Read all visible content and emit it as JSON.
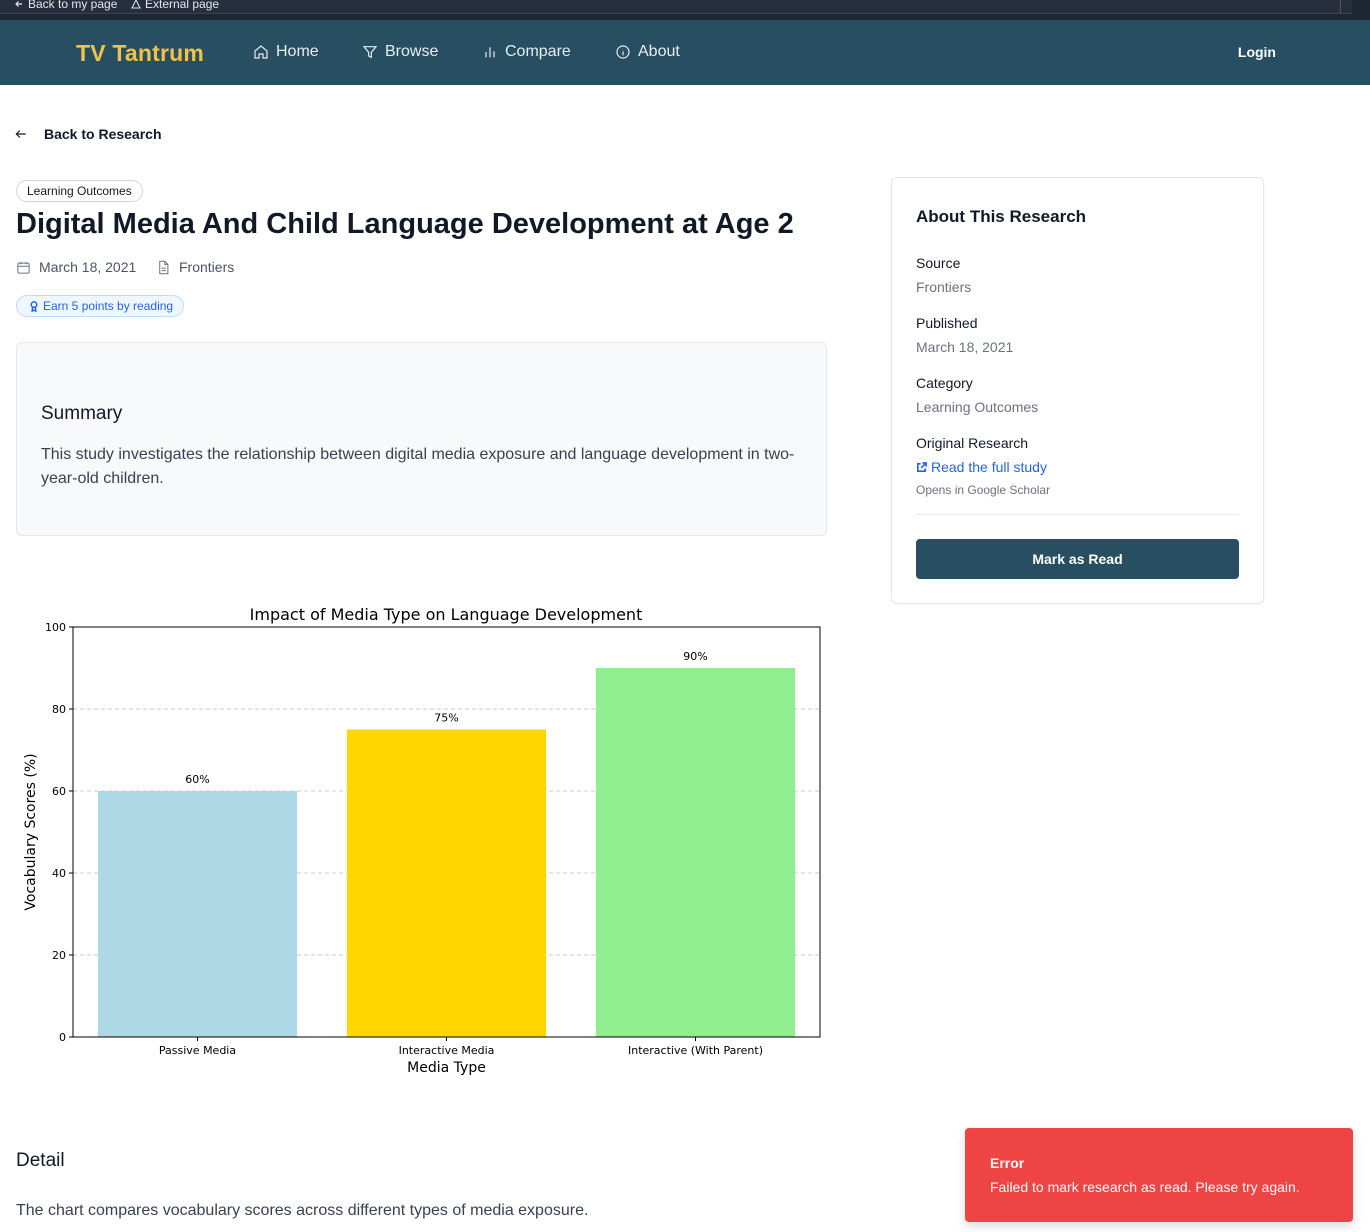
{
  "browser_bar": {
    "back_label": "Back to my page",
    "external_label": "External page"
  },
  "nav": {
    "logo": "TV Tantrum",
    "items": [
      {
        "label": "Home",
        "icon": "home-icon"
      },
      {
        "label": "Browse",
        "icon": "filter-icon"
      },
      {
        "label": "Compare",
        "icon": "bar-chart-icon"
      },
      {
        "label": "About",
        "icon": "info-icon"
      }
    ],
    "login": "Login"
  },
  "back_link": "Back to Research",
  "article": {
    "category": "Learning Outcomes",
    "title": "Digital Media And Child Language Development at Age 2",
    "date": "March 18, 2021",
    "source": "Frontiers",
    "earn_badge": "Earn 5 points by reading",
    "summary_heading": "Summary",
    "summary_text": "This study investigates the relationship between digital media exposure and language development in two-year-old children.",
    "detail_heading": "Detail",
    "detail_text": "The chart compares vocabulary scores across different types of media exposure."
  },
  "chart_data": {
    "type": "bar",
    "title": "Impact of Media Type on Language Development",
    "xlabel": "Media Type",
    "ylabel": "Vocabulary Scores (%)",
    "categories": [
      "Passive Media",
      "Interactive Media",
      "Interactive (With Parent)"
    ],
    "values": [
      60,
      75,
      90
    ],
    "data_labels": [
      "60%",
      "75%",
      "90%"
    ],
    "colors": [
      "#add8e6",
      "#ffd700",
      "#90ee90"
    ],
    "ylim": [
      0,
      100
    ],
    "yticks": [
      0,
      20,
      40,
      60,
      80,
      100
    ],
    "grid": "horizontal dashed"
  },
  "sidebar": {
    "heading": "About This Research",
    "source_label": "Source",
    "source_value": "Frontiers",
    "published_label": "Published",
    "published_value": "March 18, 2021",
    "category_label": "Category",
    "category_value": "Learning Outcomes",
    "original_label": "Original Research",
    "link_text": "Read the full study",
    "link_hint": "Opens in Google Scholar",
    "button": "Mark as Read"
  },
  "toast": {
    "title": "Error",
    "message": "Failed to mark research as read. Please try again."
  },
  "colors": {
    "nav_bg": "#274f61",
    "logo": "#f0c24b",
    "toast_bg": "#ef4444",
    "link": "#2563eb"
  }
}
